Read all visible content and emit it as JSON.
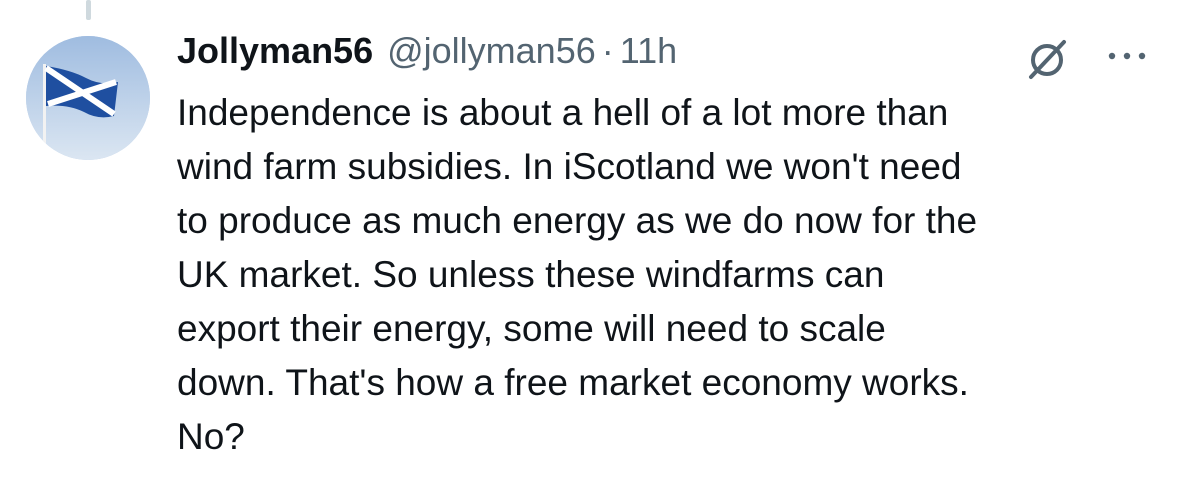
{
  "tweet": {
    "display_name": "Jollyman56",
    "handle": "@jollyman56",
    "separator": "·",
    "time": "11h",
    "text": "Independence is about a hell of a lot more than\nwind farm subsidies. In iScotland we won't need\nto produce as much energy as we do now for the\nUK market. So unless these windfarms can\nexport their energy, some will need to scale\ndown. That's how a free market economy works.\nNo?"
  },
  "icons": {
    "avatar": "saltire-flag-avatar",
    "grok": "grok-icon",
    "more": "more-options-icon"
  },
  "colors": {
    "text_primary": "#0f1419",
    "text_secondary": "#536471",
    "thread_line": "#cfd9de"
  }
}
